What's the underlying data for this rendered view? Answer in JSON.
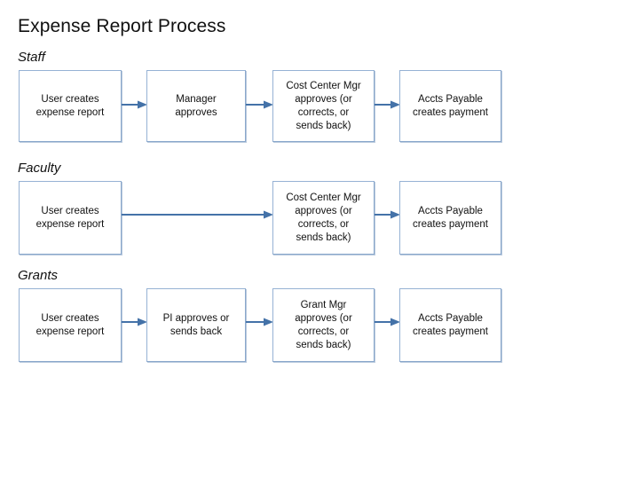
{
  "page": {
    "title": "Expense Report Process",
    "accent_color": "#4472a8",
    "box_border_color": "#96b2d4",
    "background": "#ffffff",
    "text_color": "#111111"
  },
  "diagram": {
    "type": "flowchart",
    "rows": [
      {
        "label": "Staff",
        "label_style": "italic",
        "steps": [
          {
            "text": "User creates\nexpense report"
          },
          {
            "text": "Manager\napproves"
          },
          {
            "text": "Cost Center Mgr\napproves (or\ncorrects, or\nsends back)"
          },
          {
            "text": "Accts Payable\ncreates payment"
          }
        ],
        "connectors": [
          {
            "from": 0,
            "to": 1,
            "style": "short-arrow"
          },
          {
            "from": 1,
            "to": 2,
            "style": "short-arrow"
          },
          {
            "from": 2,
            "to": 3,
            "style": "short-arrow"
          }
        ]
      },
      {
        "label": "Faculty",
        "label_style": "italic",
        "steps": [
          {
            "text": "User creates\nexpense report"
          },
          {
            "text": "Cost Center Mgr\napproves (or\ncorrects, or\nsends back)"
          },
          {
            "text": "Accts Payable\ncreates payment"
          }
        ],
        "connectors": [
          {
            "from": 0,
            "to": 1,
            "style": "long-arrow"
          },
          {
            "from": 1,
            "to": 2,
            "style": "short-arrow"
          }
        ]
      },
      {
        "label": "Grants",
        "label_style": "italic",
        "steps": [
          {
            "text": "User creates\nexpense report"
          },
          {
            "text": "PI approves or\nsends back"
          },
          {
            "text": "Grant Mgr\napproves (or\ncorrects, or\nsends back)"
          },
          {
            "text": "Accts Payable\ncreates payment"
          }
        ],
        "connectors": [
          {
            "from": 0,
            "to": 1,
            "style": "short-arrow"
          },
          {
            "from": 1,
            "to": 2,
            "style": "short-arrow"
          },
          {
            "from": 2,
            "to": 3,
            "style": "short-arrow"
          }
        ]
      }
    ]
  }
}
